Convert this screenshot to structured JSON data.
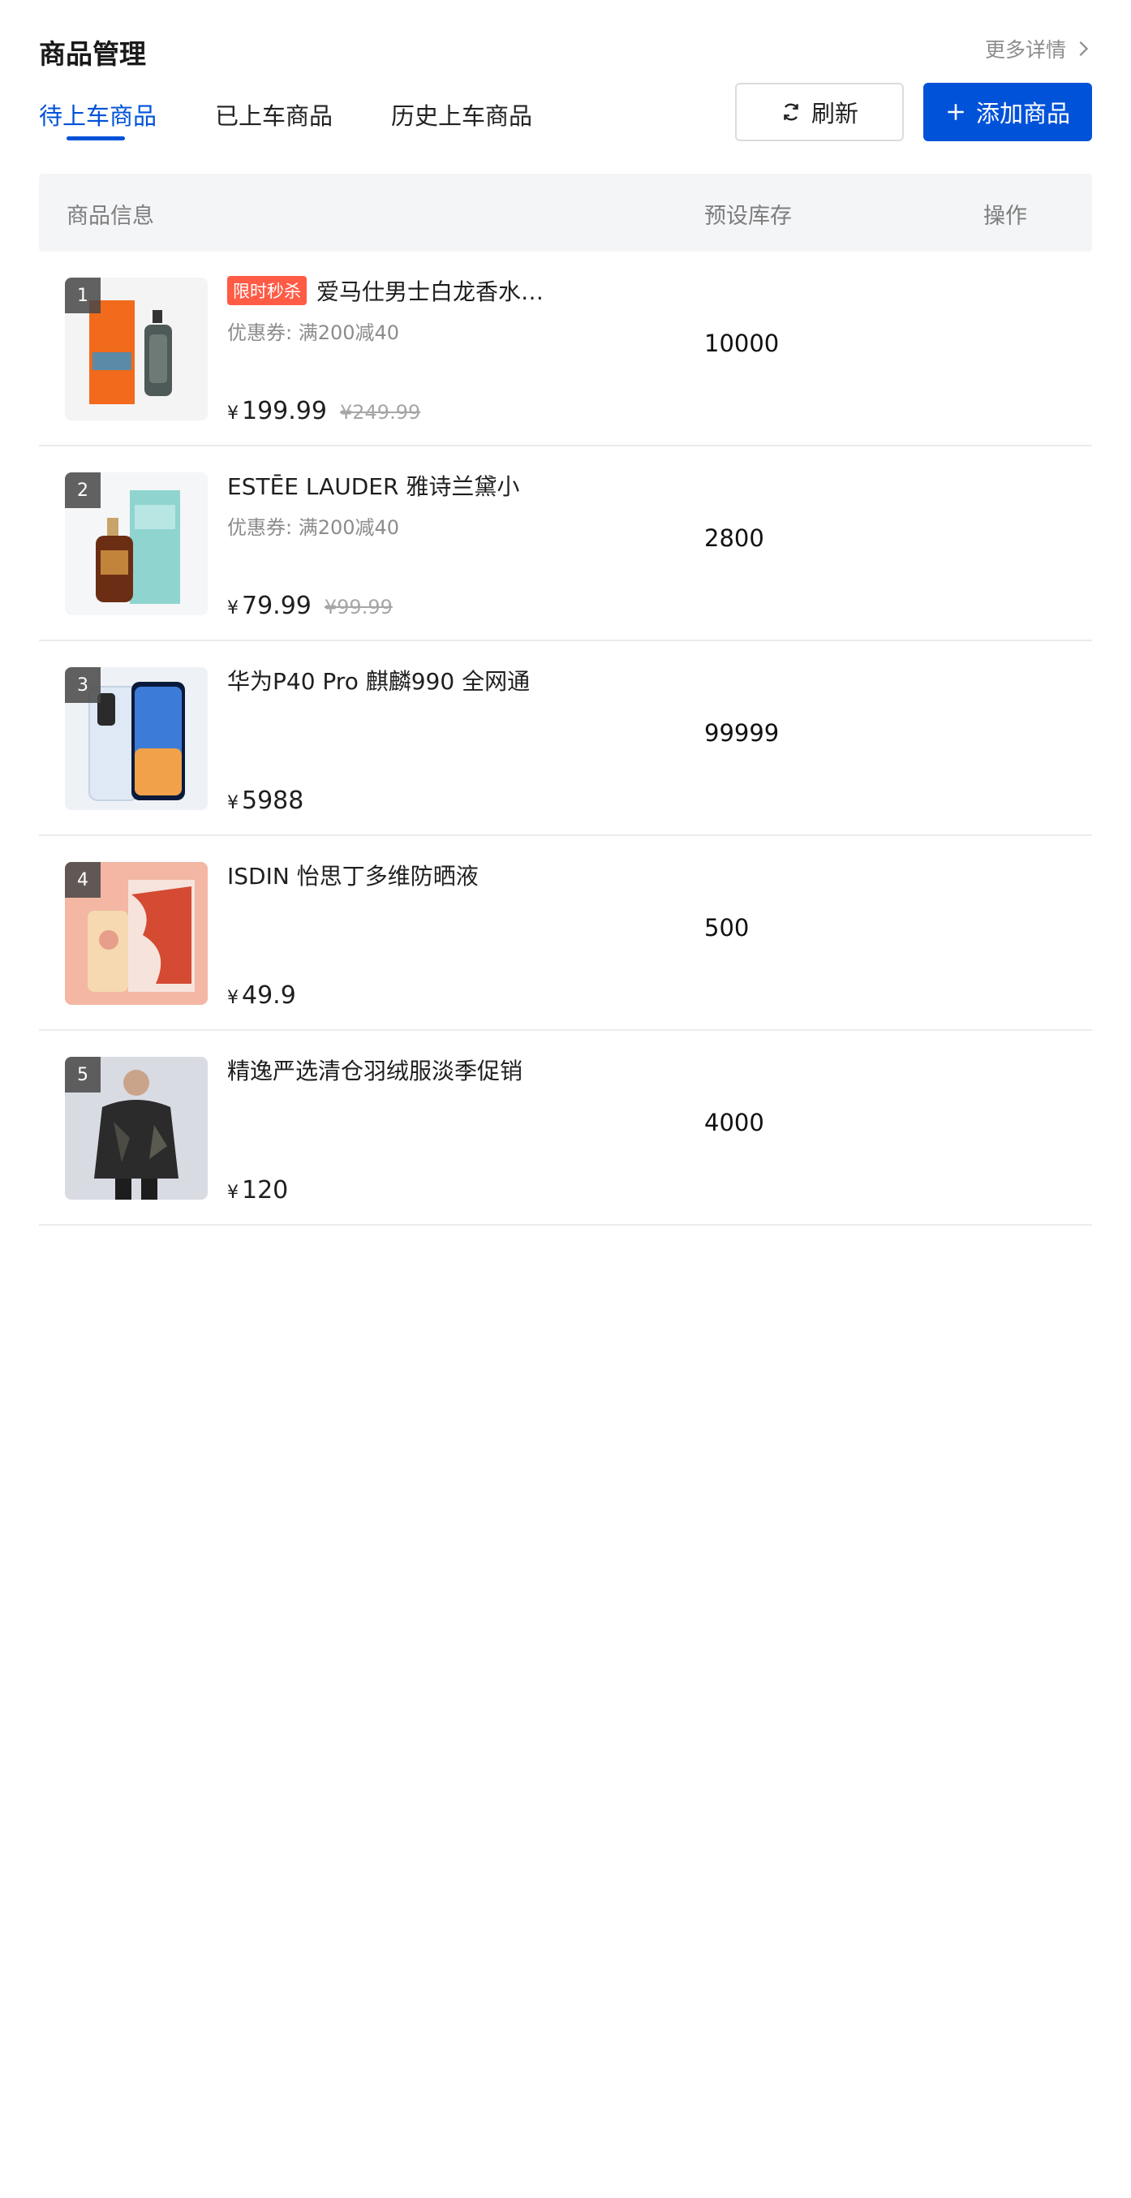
{
  "header": {
    "title": "商品管理",
    "more_label": "更多详情"
  },
  "tabs": [
    {
      "label": "待上车商品",
      "active": true
    },
    {
      "label": "已上车商品",
      "active": false
    },
    {
      "label": "历史上车商品",
      "active": false
    }
  ],
  "actions": {
    "refresh_label": "刷新",
    "add_label": "添加商品"
  },
  "table": {
    "columns": [
      "商品信息",
      "预设库存",
      "操作"
    ]
  },
  "products": [
    {
      "rank": "1",
      "tag": "限时秒杀",
      "name": "爱马仕男士白龙香水…",
      "coupon": "优惠券: 满200减40",
      "currency": "¥",
      "price": "199.99",
      "original_price": "¥249.99",
      "stock": "10000",
      "image": "perfume-bottle-image"
    },
    {
      "rank": "2",
      "tag": "",
      "name": "ESTĒE LAUDER 雅诗兰黛小",
      "coupon": "优惠券: 满200减40",
      "currency": "¥",
      "price": "79.99",
      "original_price": "¥99.99",
      "stock": "2800",
      "image": "serum-bottle-image"
    },
    {
      "rank": "3",
      "tag": "",
      "name": "华为P40 Pro 麒麟990 全网通",
      "coupon": "",
      "currency": "¥",
      "price": "5988",
      "original_price": "",
      "stock": "99999",
      "image": "smartphone-image"
    },
    {
      "rank": "4",
      "tag": "",
      "name": "ISDIN 怡思丁多维防晒液",
      "coupon": "",
      "currency": "¥",
      "price": "49.9",
      "original_price": "",
      "stock": "500",
      "image": "sunscreen-box-image"
    },
    {
      "rank": "5",
      "tag": "",
      "name": "精逸严选清仓羽绒服淡季促销",
      "coupon": "",
      "currency": "¥",
      "price": "120",
      "original_price": "",
      "stock": "4000",
      "image": "down-jacket-image"
    }
  ],
  "colors": {
    "accent": "#0052d9",
    "tag": "#ff5b45",
    "header_bg": "#f4f5f7"
  }
}
